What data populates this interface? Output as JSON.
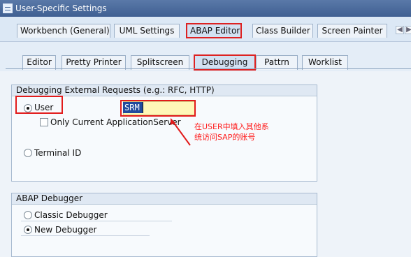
{
  "window": {
    "title": "User-Specific Settings"
  },
  "tabs": {
    "top": [
      {
        "label": "Workbench (General)"
      },
      {
        "label": "UML Settings"
      },
      {
        "label": "ABAP Editor"
      },
      {
        "label": "Class Builder"
      },
      {
        "label": "Screen Painter"
      }
    ],
    "sub": [
      {
        "label": "Editor"
      },
      {
        "label": "Pretty Printer"
      },
      {
        "label": "Splitscreen"
      },
      {
        "label": "Debugging"
      },
      {
        "label": "Pattrn"
      },
      {
        "label": "Worklist"
      }
    ]
  },
  "groups": {
    "external_requests": {
      "title": "Debugging External Requests (e.g.: RFC, HTTP)",
      "user_label": "User",
      "user_value": "SRM",
      "only_current_label": "Only Current ApplicationServer",
      "terminal_label": "Terminal ID"
    },
    "abap_debugger": {
      "title": "ABAP Debugger",
      "classic_label": "Classic Debugger",
      "new_label": "New Debugger"
    }
  },
  "annotation": {
    "text": "在USER中填入其他系统访问SAP的账号",
    "color": "#ff1b1b"
  },
  "colors": {
    "title_bar": "#4d6f9f",
    "highlight": "#e21b1b",
    "input_fill": "#fff7b8"
  },
  "icons": {
    "window": "settings-window-icon",
    "scroll_left": "scroll-left-icon",
    "scroll_right": "scroll-right-icon",
    "arrow": "annotation-arrow-icon"
  }
}
